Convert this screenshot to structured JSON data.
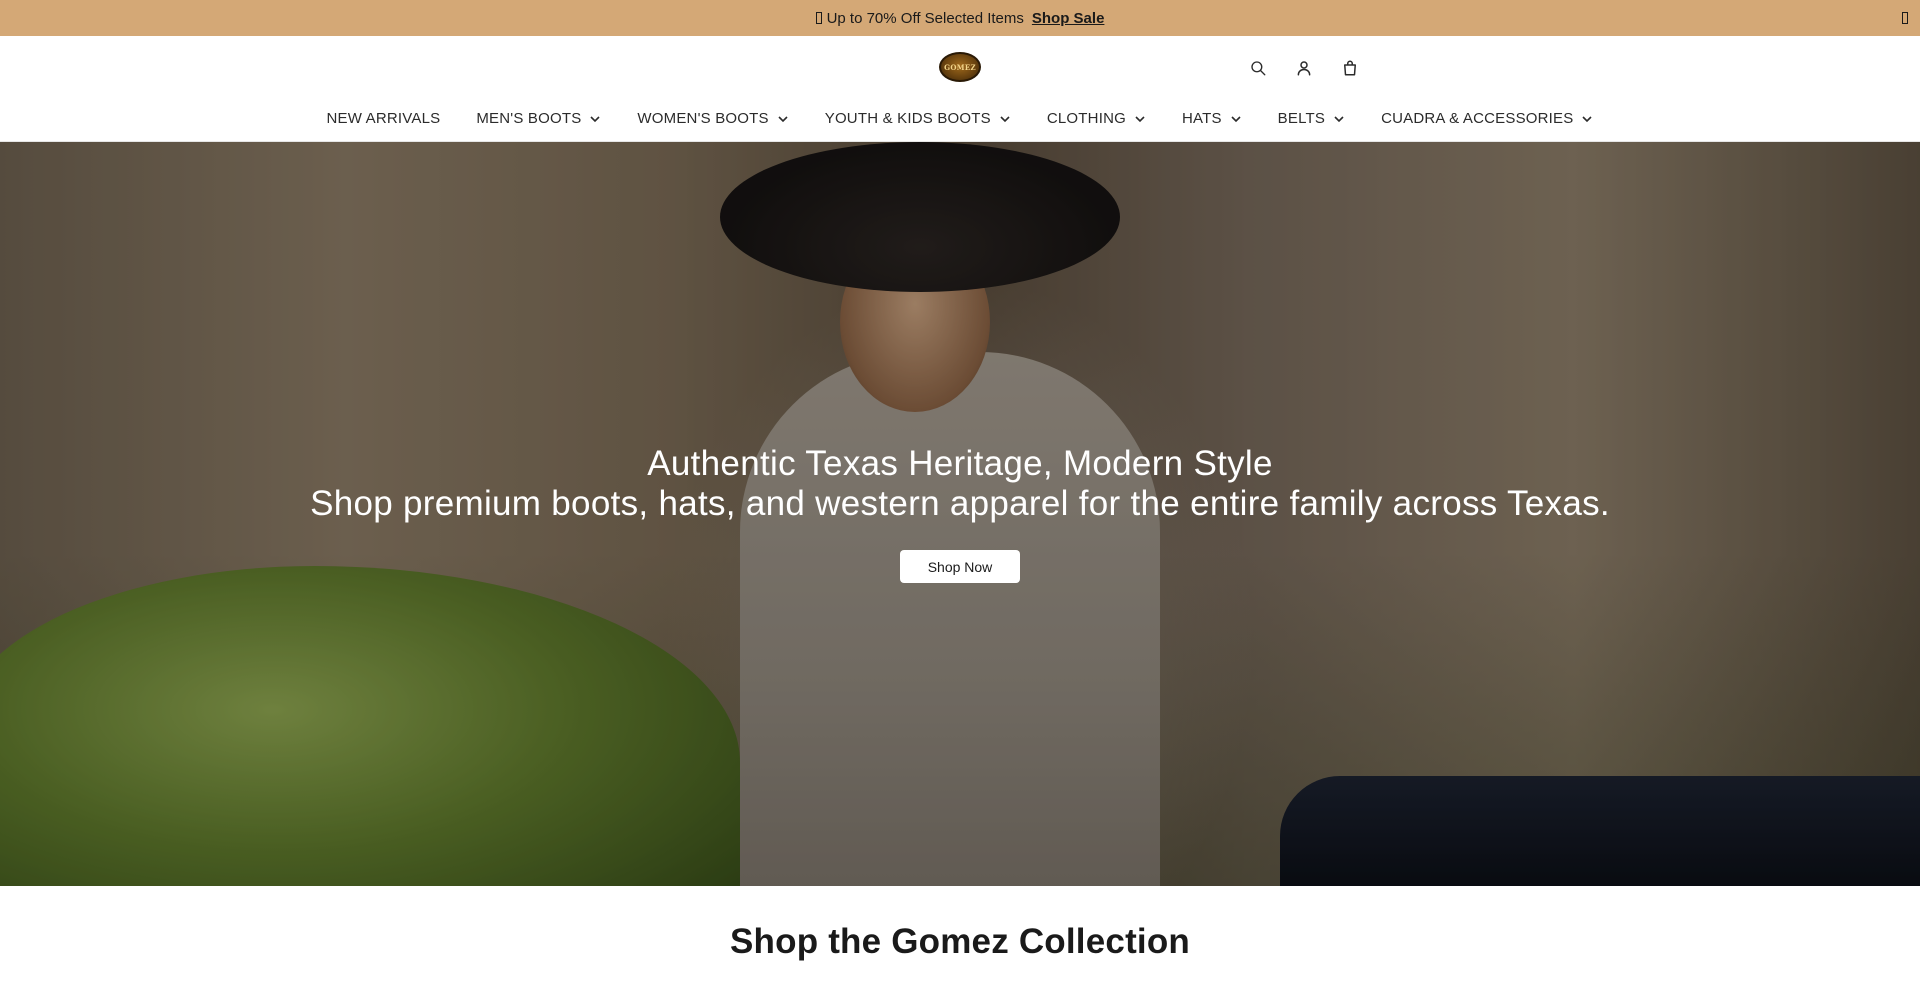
{
  "announcement": {
    "text": "Up to 70% Off Selected Items",
    "link": "Shop Sale"
  },
  "header": {
    "logo_text": "GOMEZ",
    "icons": [
      "search-icon",
      "account-icon",
      "cart-icon"
    ]
  },
  "nav": {
    "items": [
      {
        "label": "NEW ARRIVALS",
        "dropdown": false
      },
      {
        "label": "MEN'S BOOTS",
        "dropdown": true
      },
      {
        "label": "WOMEN'S BOOTS",
        "dropdown": true
      },
      {
        "label": "YOUTH & KIDS BOOTS",
        "dropdown": true
      },
      {
        "label": "CLOTHING",
        "dropdown": true
      },
      {
        "label": "HATS",
        "dropdown": true
      },
      {
        "label": "BELTS",
        "dropdown": true
      },
      {
        "label": "CUADRA & ACCESSORIES",
        "dropdown": true
      }
    ]
  },
  "hero": {
    "title": "Authentic Texas Heritage, Modern Style",
    "subtitle": "Shop premium boots, hats, and western apparel for the entire family across Texas.",
    "cta": "Shop Now"
  },
  "collection": {
    "title": "Shop the Gomez Collection"
  },
  "colors": {
    "announcement_bg": "#d4a876",
    "text": "#1a1a1a",
    "white": "#ffffff"
  }
}
